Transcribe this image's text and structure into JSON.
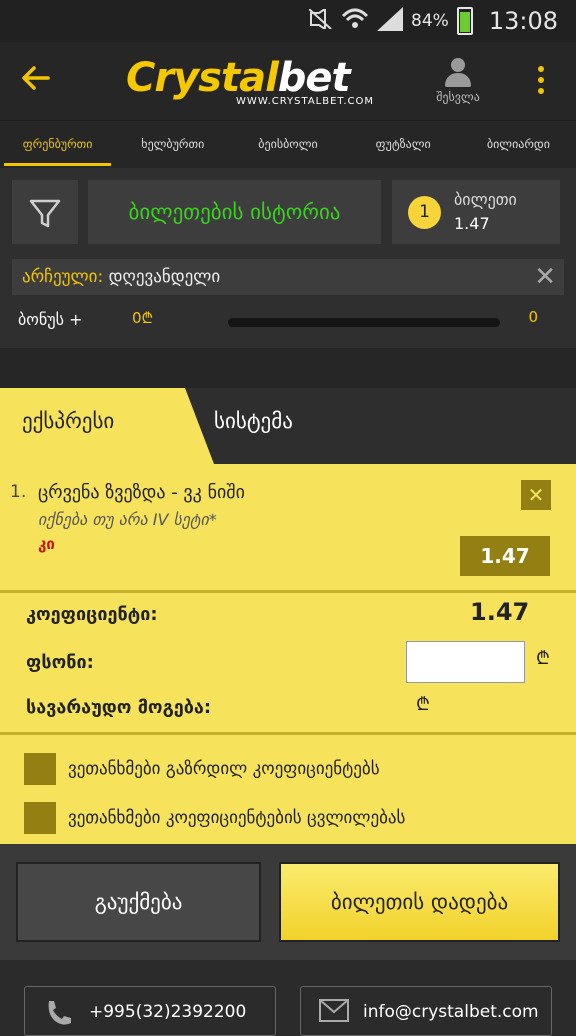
{
  "status_bar": {
    "battery": "84%",
    "time": "13:08"
  },
  "header": {
    "brand_part1": "Crystal",
    "brand_part2": "bet",
    "url": "WWW.CRYSTALBET.COM",
    "login_label": "შესვლა"
  },
  "sport_tabs": [
    {
      "label": "ფრენბურთი",
      "active": true
    },
    {
      "label": "ხელბურთი",
      "active": false
    },
    {
      "label": "ბეისბოლი",
      "active": false
    },
    {
      "label": "ფუტზალი",
      "active": false
    },
    {
      "label": "ბილიარდი",
      "active": false
    }
  ],
  "panel": {
    "history_label": "ბილეთების ისტორია",
    "ticket_count": "1",
    "ticket_label": "ბილეთი",
    "ticket_value": "1.47",
    "selected_label": "არჩეული:",
    "selected_value": "დღევანდელი",
    "bonus_label": "ბონუს +",
    "bonus_amount": "0₾",
    "bonus_end": "0",
    "bonus_progress": 0
  },
  "bet_types": {
    "express": "ექსპრესი",
    "system": "სისტემა"
  },
  "coupon": {
    "events": [
      {
        "number": "1.",
        "title": "ცრვენა ზვეზდა - ვკ ნიში",
        "market": "იქნება თუ არა IV სეტი*",
        "pick": "კი",
        "odd": "1.47"
      }
    ],
    "coef_label": "კოეფიციენტი:",
    "coef_value": "1.47",
    "stake_label": "ფსონი:",
    "stake_value": "",
    "currency_symbol": "₾",
    "win_label": "სავარაუდო მოგება:",
    "win_currency": "₾",
    "checkboxes": [
      {
        "label": "ვეთანხმები გაზრდილ კოეფიციენტებს",
        "checked": false
      },
      {
        "label": "ვეთანხმები კოეფიციენტების ცვლილებას",
        "checked": false
      }
    ]
  },
  "actions": {
    "cancel": "გაუქმება",
    "place": "ბილეთის დადება"
  },
  "footer": {
    "phone": "+995(32)2392200",
    "email": "info@crystalbet.com"
  },
  "icons": {
    "back": "back-arrow-icon",
    "user": "user-icon",
    "menu": "more-vertical-icon",
    "filter": "filter-funnel-icon",
    "clear": "close-icon",
    "phone": "phone-icon",
    "email": "mail-icon"
  },
  "colors": {
    "accent": "#f2c500",
    "coupon_bg": "#f7e35b",
    "history_green": "#38d31c",
    "pick_red": "#d40f0f"
  }
}
